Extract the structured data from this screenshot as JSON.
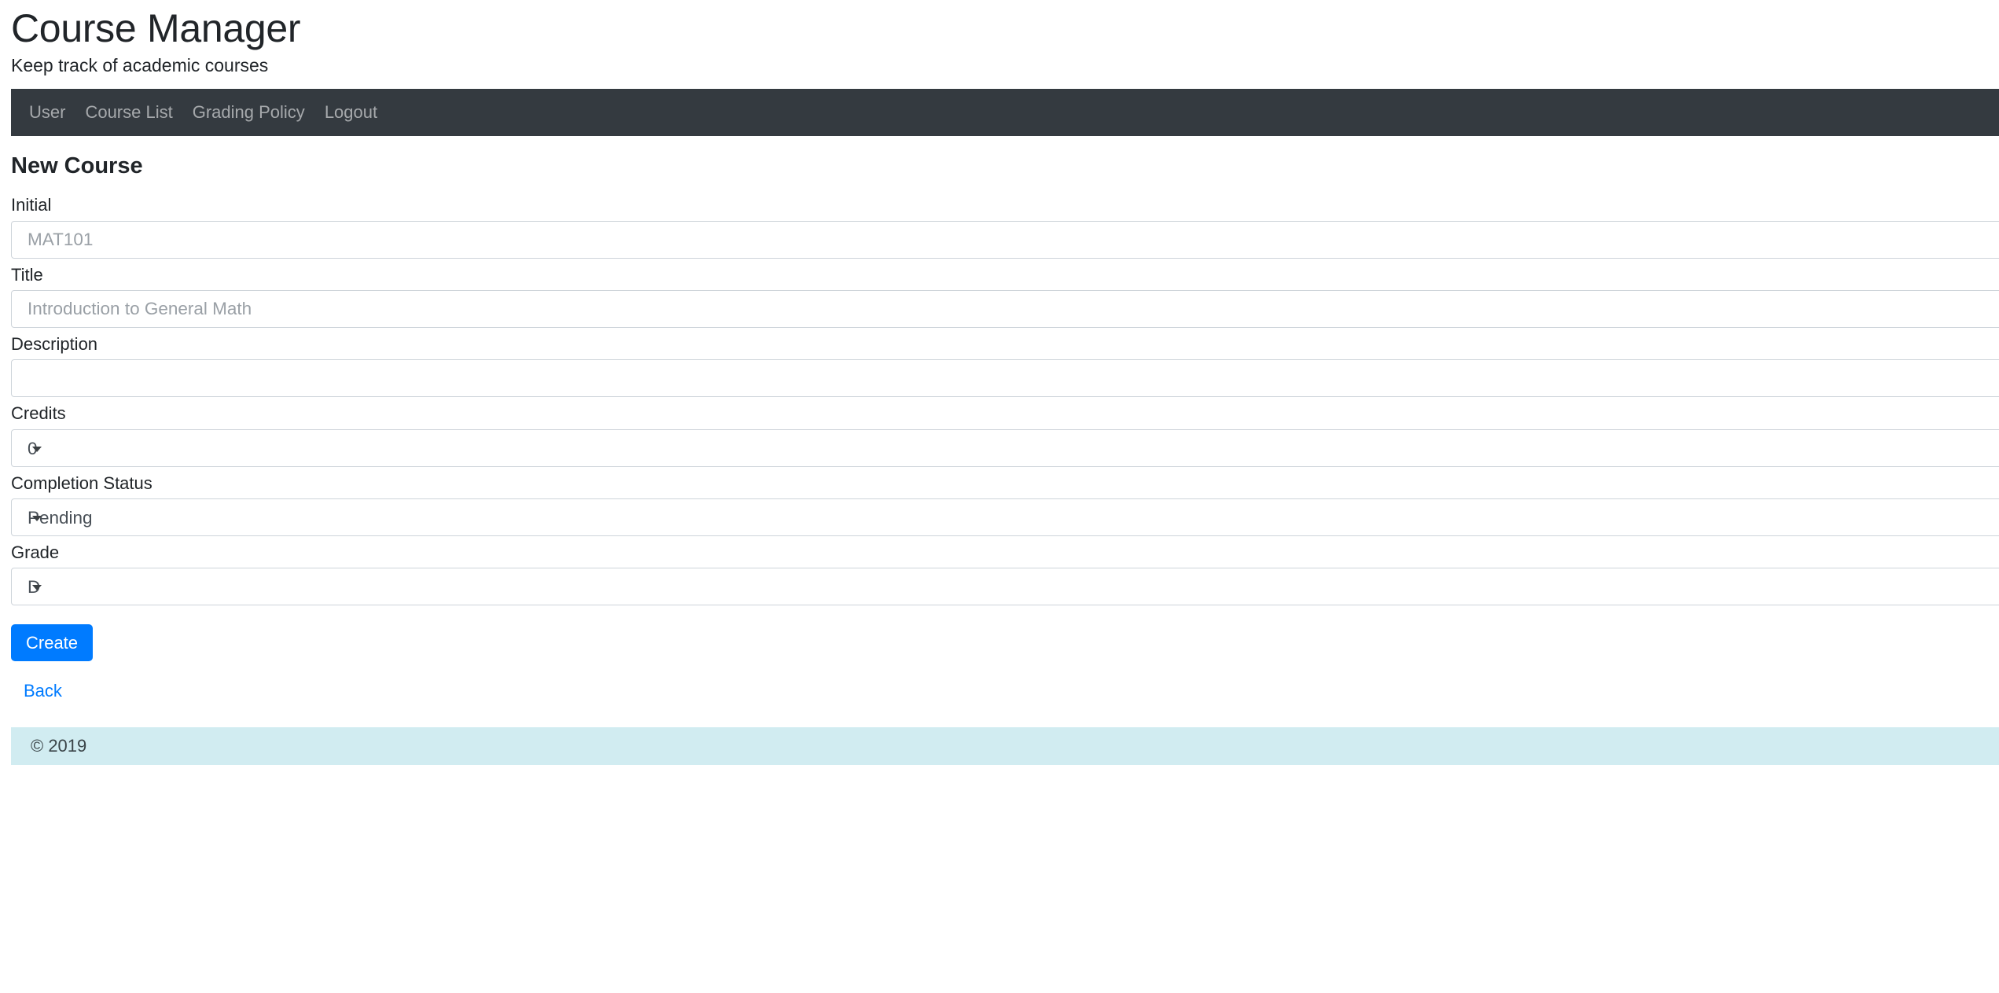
{
  "app": {
    "title": "Course Manager",
    "subtitle": "Keep track of academic courses"
  },
  "nav": {
    "items": [
      {
        "label": "User",
        "name": "nav-item-user"
      },
      {
        "label": "Course List",
        "name": "nav-item-course-list"
      },
      {
        "label": "Grading Policy",
        "name": "nav-item-grading-policy"
      },
      {
        "label": "Logout",
        "name": "nav-item-logout"
      }
    ]
  },
  "main": {
    "heading": "New Course",
    "fields": {
      "initial": {
        "label": "Initial",
        "value": "",
        "placeholder": "MAT101"
      },
      "title": {
        "label": "Title",
        "value": "",
        "placeholder": "Introduction to General Math"
      },
      "description": {
        "label": "Description",
        "value": "",
        "placeholder": ""
      },
      "credits": {
        "label": "Credits",
        "selected": "0"
      },
      "completion_status": {
        "label": "Completion Status",
        "selected": "Pending"
      },
      "grade": {
        "label": "Grade",
        "selected": "D"
      }
    },
    "submit_label": "Create",
    "back_label": "Back"
  },
  "footer": {
    "copyright": "© 2019"
  },
  "colors": {
    "navbar_bg": "#343a40",
    "primary": "#007bff",
    "footer_bg": "#d1ecf1",
    "border": "#ced4da",
    "text": "#212529",
    "placeholder": "#9aa0a6"
  }
}
